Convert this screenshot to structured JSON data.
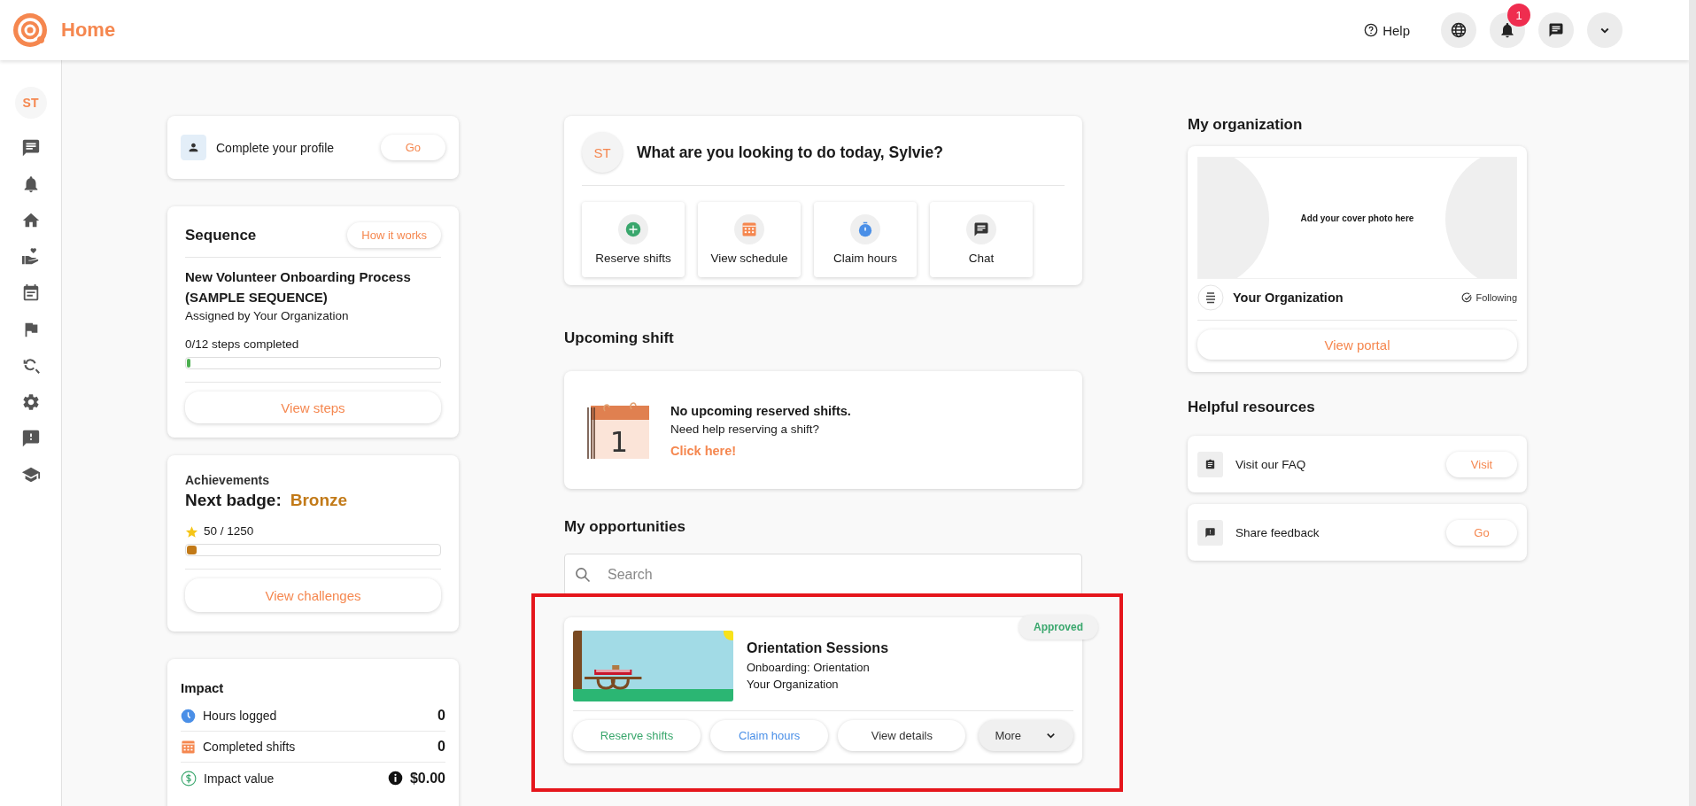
{
  "header": {
    "title": "Home",
    "help": "Help",
    "notification_count": "1"
  },
  "rail": {
    "avatar": "ST"
  },
  "profile": {
    "label": "Complete your profile",
    "button": "Go"
  },
  "sequence": {
    "title": "Sequence",
    "help_button": "How it works",
    "name": "New Volunteer Onboarding Process (SAMPLE SEQUENCE)",
    "assigned": "Assigned by Your Organization",
    "progress_text": "0/12 steps completed",
    "level": 0.01,
    "button": "View steps"
  },
  "achievements": {
    "title": "Achievements",
    "badge_label": "Next badge:",
    "badge": "Bronze",
    "points": "50 / 1250",
    "level": 0.04,
    "button": "View challenges"
  },
  "impact": {
    "title": "Impact",
    "rows": [
      {
        "kind": "hours",
        "label": "Hours logged",
        "value": "0"
      },
      {
        "kind": "shifts",
        "label": "Completed shifts",
        "value": "0"
      },
      {
        "kind": "money",
        "label": "Impact value",
        "value": "$0.00"
      }
    ]
  },
  "greeting": {
    "avatar": "ST",
    "text": "What are you looking to do today, Sylvie?",
    "actions": [
      {
        "kind": "reserve",
        "label": "Reserve shifts"
      },
      {
        "kind": "schedule",
        "label": "View schedule"
      },
      {
        "kind": "claim",
        "label": "Claim hours"
      },
      {
        "kind": "chat",
        "label": "Chat"
      }
    ]
  },
  "upcoming": {
    "title": "Upcoming shift",
    "calendar_day": "1",
    "message": "No upcoming reserved shifts.",
    "help": "Need help reserving a shift?",
    "link": "Click here!"
  },
  "opportunities": {
    "title": "My opportunities",
    "search": {
      "placeholder": "Search"
    },
    "items": [
      {
        "title": "Orientation Sessions",
        "subtitle": "Onboarding: Orientation",
        "organization": "Your Organization",
        "status": "Approved",
        "highlighted": true,
        "actions": [
          {
            "kind": "reserve",
            "label": "Reserve shifts"
          },
          {
            "kind": "claim",
            "label": "Claim hours"
          },
          {
            "kind": "details",
            "label": "View details"
          },
          {
            "kind": "more",
            "label": "More"
          }
        ]
      }
    ]
  },
  "organization": {
    "title": "My organization",
    "cover_text": "Add your cover photo here",
    "name": "Your Organization",
    "follow_status": "Following",
    "button": "View portal"
  },
  "resources": {
    "title": "Helpful resources",
    "items": [
      {
        "kind": "faq",
        "label": "Visit our FAQ",
        "button": "Visit"
      },
      {
        "kind": "feedback",
        "label": "Share feedback",
        "button": "Go"
      }
    ]
  }
}
